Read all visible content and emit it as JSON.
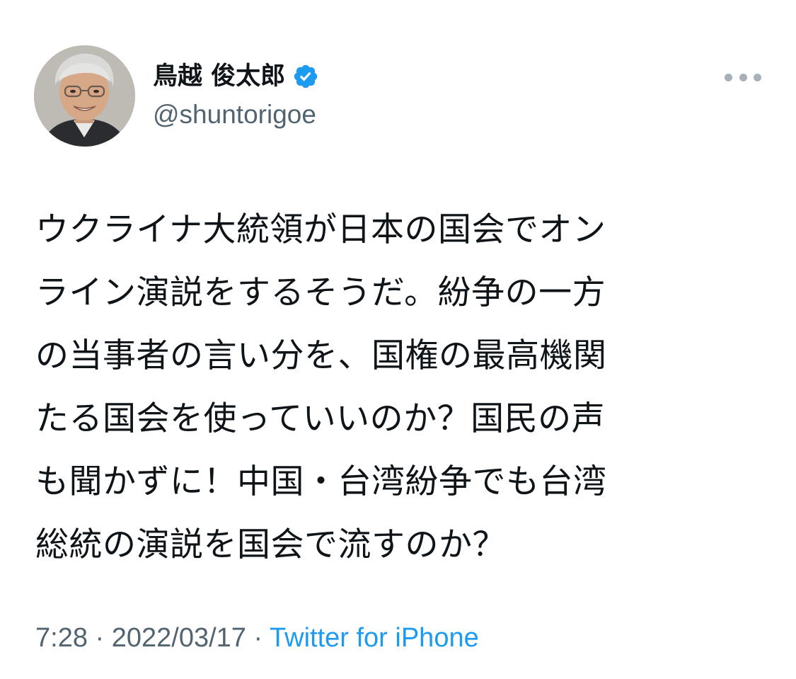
{
  "author": {
    "display_name": "鳥越 俊太郎",
    "handle": "@shuntorigoe",
    "verified": true,
    "avatar_icon": "profile-photo"
  },
  "more_icon": "more-horizontal-icon",
  "tweet": {
    "lines": [
      "ウクライナ大統領が日本の国会でオン",
      "ライン演説をするそうだ。紛争の一方",
      "の当事者の言い分を、国権の最高機関",
      "たる国会を使っていいのか？国民の声",
      "も聞かずに！中国・台湾紛争でも台湾",
      "総統の演説を国会で流すのか？"
    ]
  },
  "meta": {
    "time": "7:28",
    "separator": "·",
    "date": "2022/03/17",
    "source": "Twitter for iPhone"
  },
  "colors": {
    "text": "#0f1419",
    "secondary": "#536471",
    "link": "#1d9bf0",
    "verified_badge": "#1d9bf0"
  }
}
